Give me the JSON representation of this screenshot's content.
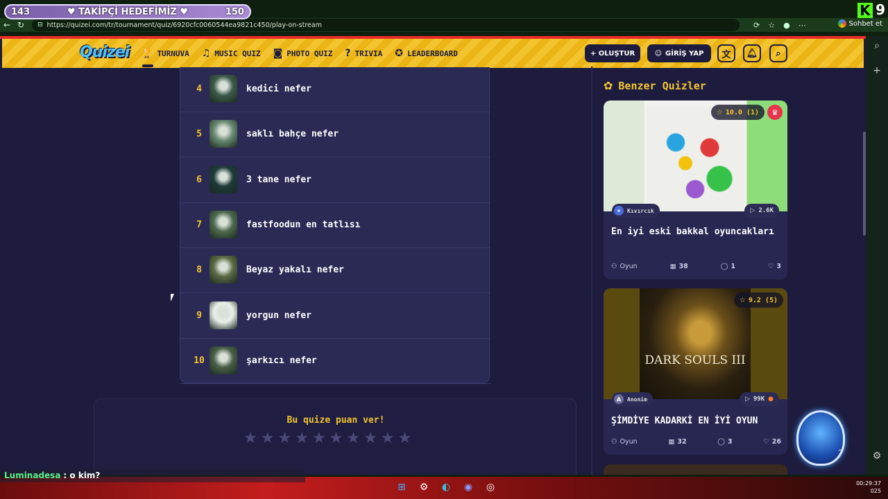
{
  "overlay": {
    "left_count": "143",
    "goal_label": "♥ TAKİPÇİ HEDEFİMİZ ♥",
    "right_count": "150",
    "kick_letter": "K",
    "kick_number": "9"
  },
  "browser": {
    "url": "https://quizei.com/tr/tournament/quiz/6920cfc0060544ea9821c450/play-on-stream",
    "chat_button": "Sohbet et"
  },
  "header": {
    "logo": "Quizei",
    "menu": [
      {
        "label": "TURNUVA",
        "icon": "trophy-icon"
      },
      {
        "label": "MUSIC QUIZ",
        "icon": "music-note-icon"
      },
      {
        "label": "PHOTO QUIZ",
        "icon": "camera-icon"
      },
      {
        "label": "TRIVIA",
        "icon": "question-bubble-icon"
      },
      {
        "label": "LEADERBOARD",
        "icon": "medal-icon"
      }
    ],
    "create_label": "+ OLUŞTUR",
    "login_label": "GİRİŞ YAP"
  },
  "ranking": [
    {
      "rank": "4",
      "name": "kedici nefer",
      "color": "#3d5a4a"
    },
    {
      "rank": "5",
      "name": "saklı bahçe nefer",
      "color": "#6b8a72"
    },
    {
      "rank": "6",
      "name": "3 tane nefer",
      "color": "#1e3a3a"
    },
    {
      "rank": "7",
      "name": "fastfoodun en tatlısı",
      "color": "#4f6b50"
    },
    {
      "rank": "8",
      "name": "Beyaz yakalı nefer",
      "color": "#5c6b45"
    },
    {
      "rank": "9",
      "name": "yorgun nefer",
      "color": "#e8eee8"
    },
    {
      "rank": "10",
      "name": "şarkıcı nefer",
      "color": "#4a6048"
    }
  ],
  "rate": {
    "title": "Bu quize puan ver!",
    "stars": 10
  },
  "similar": {
    "title": "Benzer Quizler",
    "cards": [
      {
        "rating": "10.0 (1)",
        "author": "Kıvırcık",
        "plays": "2.6K",
        "title": "En iyi eski bakkal oyuncakları",
        "type": "Oyun",
        "items": "38",
        "comments": "1",
        "likes": "3"
      },
      {
        "rating": "9.2 (5)",
        "author": "Anonim",
        "author_initial": "A",
        "plays": "99K",
        "image_text": "DARK SOULS III",
        "title": "ŞİMDİYE KADARKİ EN İYİ OYUN",
        "type": "Oyun",
        "items": "32",
        "comments": "3",
        "likes": "26"
      }
    ]
  },
  "chat": {
    "user": "Luminadesa",
    "message": ": o kim?"
  },
  "clock": {
    "time": "00:29:37",
    "date": "025"
  }
}
